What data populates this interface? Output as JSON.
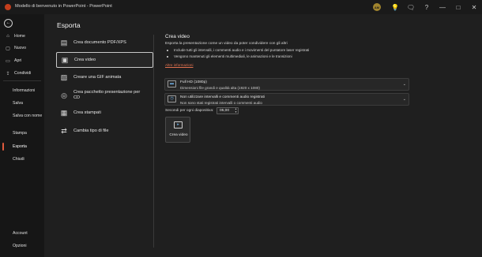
{
  "window": {
    "title": "Modello di benvenuto in PowerPoint  -  PowerPoint",
    "avatar_initials": "AM",
    "controls": [
      "?",
      "—",
      "□",
      "✕"
    ]
  },
  "sidebar": {
    "top_items": [
      {
        "label": "Home",
        "icon": "home-icon"
      },
      {
        "label": "Nuovo",
        "icon": "new-file-icon"
      },
      {
        "label": "Apri",
        "icon": "folder-icon"
      },
      {
        "label": "Condividi",
        "icon": "share-icon"
      }
    ],
    "text_items": [
      "Informazioni",
      "Salva",
      "Salva con nome",
      "Stampa",
      "Esporta",
      "Chiudi"
    ],
    "active": "Esporta",
    "bottom_items": [
      "Account",
      "Opzioni"
    ]
  },
  "main": {
    "title": "Esporta",
    "options": [
      {
        "label": "Crea documento PDF/XPS",
        "icon": "pdf-icon"
      },
      {
        "label": "Crea video",
        "icon": "video-icon"
      },
      {
        "label": "Creare una GIF animata",
        "icon": "gif-icon"
      },
      {
        "label": "Crea pacchetto presentazione per CD",
        "icon": "cd-package-icon"
      },
      {
        "label": "Crea stampati",
        "icon": "handouts-icon"
      },
      {
        "label": "Cambia tipo di file",
        "icon": "change-file-type-icon"
      }
    ],
    "selected_option": "Crea video"
  },
  "video": {
    "title": "Crea video",
    "description": "Esporta la presentazione come un video da poter condividere con gli altri",
    "bullets": [
      "Include tutti gli intervalli, i commenti audio e i movimenti del puntatore laser registrati",
      "Vengono mantenuti gli elementi multimediali, le animazioni e le transizioni"
    ],
    "info_link": "Altre informazioni",
    "quality": {
      "selected": "Full HD (1080p)",
      "detail": "Dimensioni file grandi e qualità alta (1920 x 1080)"
    },
    "timings": {
      "selected": "Non utilizzare intervalli e commenti audio registrati",
      "detail": "Non sono stati registrati intervalli o commenti audio"
    },
    "seconds_label": "Secondi per ogni diapositiva:",
    "seconds_value": "05,00",
    "create_button": "Crea video"
  },
  "colors": {
    "accent": "#e05a3d",
    "link": "#e2714f",
    "background": "#1f1f1f",
    "sidebar": "#161616"
  }
}
